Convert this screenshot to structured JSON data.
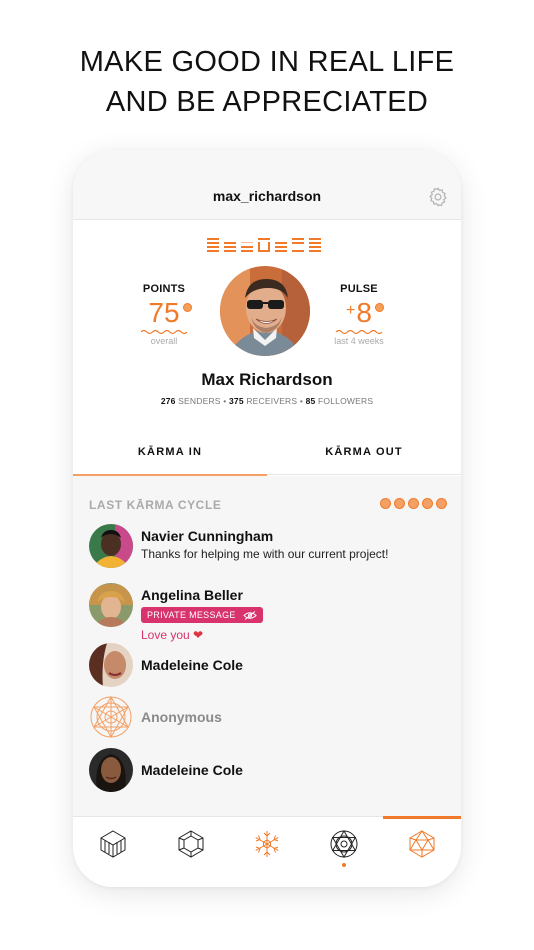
{
  "headline": {
    "line1": "MAKE GOOD IN REAL LIFE",
    "line2": "AND BE APPRECIATED"
  },
  "topbar": {
    "username": "max_richardson",
    "settings_icon": "gear-icon"
  },
  "profile": {
    "points_label": "POINTS",
    "points_value": "75",
    "points_sub": "overall",
    "pulse_label": "PULSE",
    "pulse_prefix": "+",
    "pulse_value": "8",
    "pulse_sub": "last 4 weeks",
    "full_name": "Max Richardson",
    "senders_count": "276",
    "senders_label": "SENDERS",
    "receivers_count": "375",
    "receivers_label": "RECEIVERS",
    "followers_count": "85",
    "followers_label": "FOLLOWERS"
  },
  "tabs": [
    {
      "label": "KĀRMA IN",
      "active": true
    },
    {
      "label": "KĀRMA OUT",
      "active": false
    }
  ],
  "feed": {
    "section_title": "LAST KĀRMA CYCLE",
    "cycle_dots": 5,
    "items": [
      {
        "name": "Navier Cunningham",
        "message": "Thanks for helping me with our current project!"
      },
      {
        "name": "Angelina Beller",
        "badge": "PRIVATE MESSAGE",
        "message": "Love you"
      },
      {
        "name": "Madeleine Cole"
      },
      {
        "name": "Anonymous"
      },
      {
        "name": "Madeleine Cole"
      }
    ]
  },
  "colors": {
    "accent": "#f07a2a",
    "private": "#d8336d"
  },
  "nav": {
    "items": [
      "cube-icon",
      "hexagon-icon",
      "snowflake-icon",
      "mandala-icon",
      "icosahedron-icon"
    ],
    "active_index": 4
  }
}
